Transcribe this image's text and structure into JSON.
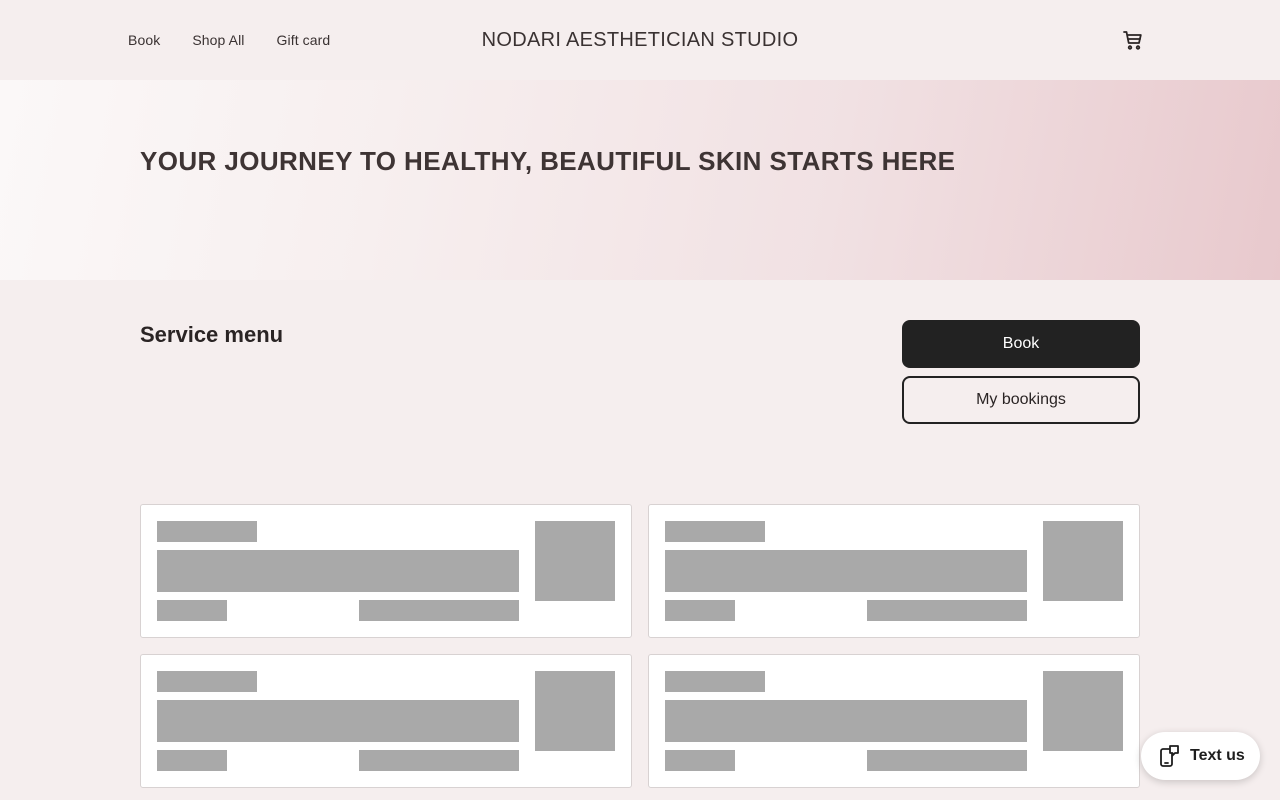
{
  "header": {
    "nav": [
      "Book",
      "Shop All",
      "Gift card"
    ],
    "brand": "NODARI AESTHETICIAN STUDIO",
    "cart_icon": "cart-icon"
  },
  "hero": {
    "title": "YOUR JOURNEY TO HEALTHY, BEAUTIFUL SKIN STARTS HERE"
  },
  "services": {
    "title": "Service menu",
    "book_label": "Book",
    "my_bookings_label": "My bookings",
    "cards_loading": 4
  },
  "widget": {
    "label": "Text us",
    "icon": "chat-phone-icon"
  },
  "colors": {
    "background": "#f5eeee",
    "primary_button": "#222222",
    "skeleton": "#a9a9a9",
    "hero_accent": "#e8c9cd"
  }
}
